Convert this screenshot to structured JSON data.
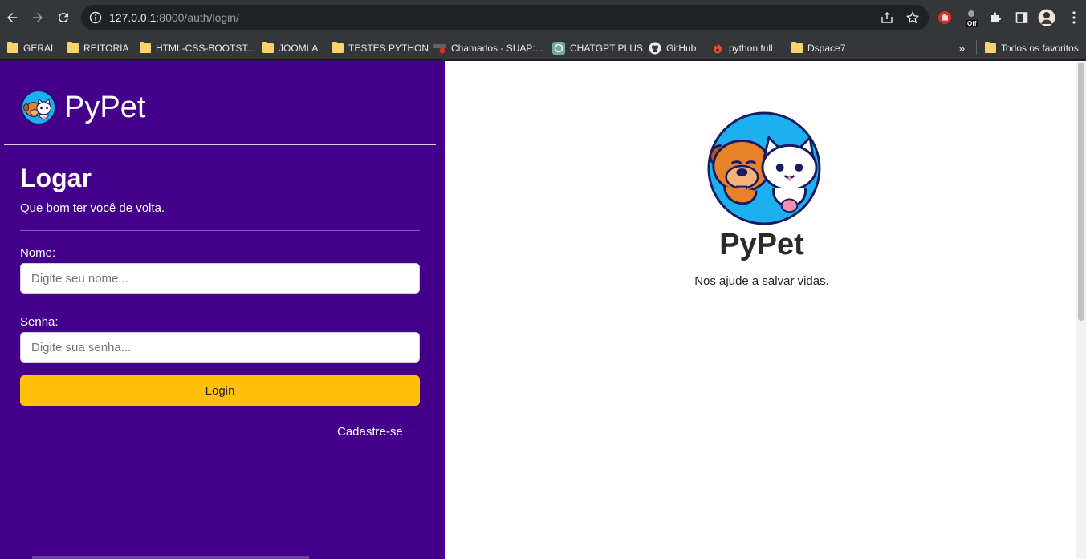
{
  "browser": {
    "url_host": "127.0.0.1",
    "url_path": ":8000/auth/login/",
    "extension_badge": "Off",
    "bookmarks": [
      {
        "label": "GERAL",
        "icon": "folder-icon"
      },
      {
        "label": "REITORIA",
        "icon": "folder-icon"
      },
      {
        "label": "HTML-CSS-BOOTST...",
        "icon": "folder-icon"
      },
      {
        "label": "JOOMLA",
        "icon": "folder-icon"
      },
      {
        "label": "TESTES PYTHON",
        "icon": "folder-icon"
      },
      {
        "label": "Chamados - SUAP:...",
        "icon": "suap-icon"
      },
      {
        "label": "CHATGPT PLUS",
        "icon": "chatgpt-icon"
      },
      {
        "label": "GitHub",
        "icon": "github-icon"
      },
      {
        "label": "python full",
        "icon": "hotmart-icon"
      },
      {
        "label": "Dspace7",
        "icon": "folder-icon"
      }
    ],
    "overflow": "»",
    "all_bookmarks": "Todos os favoritos"
  },
  "sidebar": {
    "brand": "PyPet",
    "heading": "Logar",
    "subtitle": "Que bom ter você de volta.",
    "name_label": "Nome:",
    "name_placeholder": "Digite seu nome...",
    "password_label": "Senha:",
    "password_placeholder": "Digite sua senha...",
    "login_button": "Login",
    "register_link": "Cadastre-se"
  },
  "hero": {
    "title": "PyPet",
    "subtitle": "Nos ajude a salvar vidas."
  },
  "colors": {
    "sidebar_bg": "#44008b",
    "button_bg": "#ffc107",
    "logo_ring": "#1db0f0"
  }
}
